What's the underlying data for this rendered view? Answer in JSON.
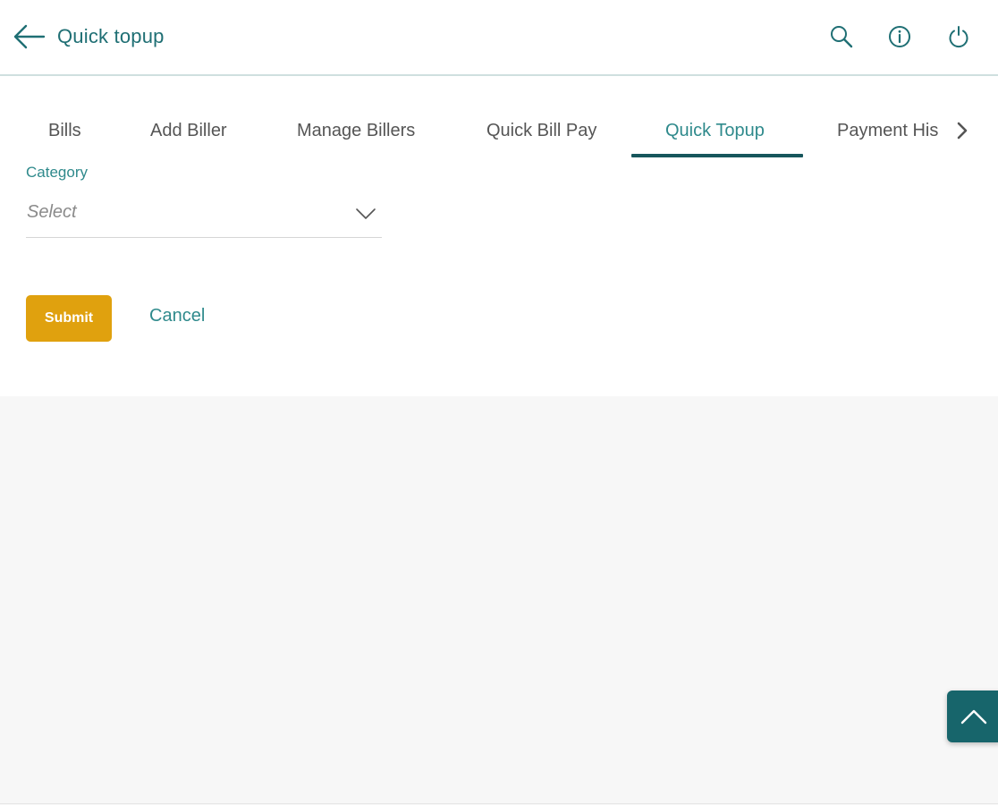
{
  "header": {
    "back_icon": "arrow-left-icon",
    "title": "Quick topup",
    "icons": [
      "search-icon",
      "info-icon",
      "power-icon"
    ],
    "accent_color": "#1f6f74"
  },
  "tabs": {
    "items": [
      {
        "label": "Bills",
        "active": false
      },
      {
        "label": "Add Biller",
        "active": false
      },
      {
        "label": "Manage Billers",
        "active": false
      },
      {
        "label": "Quick Bill Pay",
        "active": false
      },
      {
        "label": "Quick Topup",
        "active": true
      },
      {
        "label": "Payment His",
        "active": false
      }
    ],
    "next_icon": "chevron-right-icon",
    "active_color": "#17565c"
  },
  "form": {
    "category_label": "Category",
    "category_value": "Select",
    "category_icon": "chevron-down-icon"
  },
  "actions": {
    "submit_label": "Submit",
    "cancel_label": "Cancel",
    "submit_color": "#e0a10e"
  },
  "scroll_top": {
    "icon": "chevron-up-icon",
    "color": "#17656b"
  }
}
